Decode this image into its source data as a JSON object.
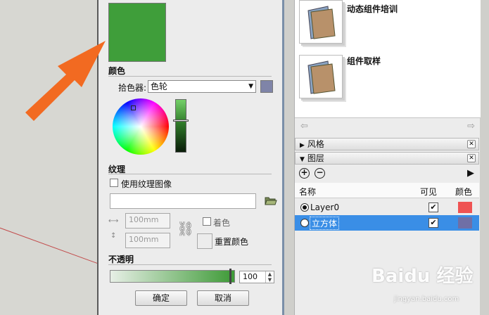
{
  "dialog": {
    "color_section": "颜色",
    "picker_label": "拾色器:",
    "picker_value": "色轮",
    "texture_section": "纹理",
    "use_texture_label": "使用纹理图像",
    "width_value": "100mm",
    "height_value": "100mm",
    "colorize_label": "着色",
    "reset_color_label": "重置颜色",
    "opacity_section": "不透明",
    "opacity_value": "100",
    "ok_label": "确定",
    "cancel_label": "取消",
    "swatch_color": "#3f9e3a",
    "picker_swatch_color": "#7f84a8"
  },
  "components": {
    "items": [
      {
        "name": "动态组件培训"
      },
      {
        "name": "组件取样"
      }
    ]
  },
  "trays": {
    "style_title": "风格",
    "layers_title": "图层"
  },
  "layers": {
    "headers": {
      "name": "名称",
      "visible": "可见",
      "color": "颜色"
    },
    "rows": [
      {
        "name": "Layer0",
        "active": true,
        "visible": true,
        "color": "#ef5353",
        "selected": false
      },
      {
        "name": "立方体",
        "active": false,
        "visible": true,
        "color": "#6f6fa6",
        "selected": true
      }
    ]
  },
  "watermark": {
    "text": "Baidu 经验",
    "sub": "jingyan.baidu.com"
  }
}
